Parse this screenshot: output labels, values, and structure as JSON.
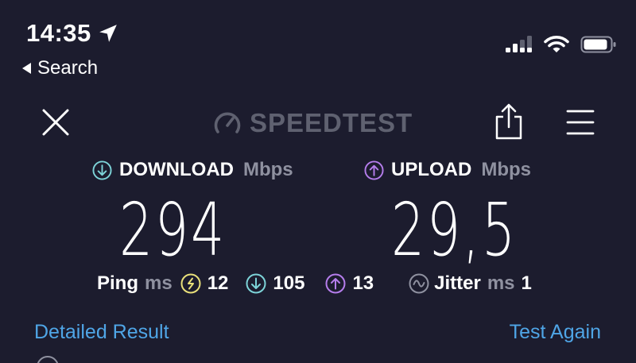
{
  "status_bar": {
    "time": "14:35",
    "back_label": "Search",
    "icons": [
      "location-arrow-icon",
      "cellular-signal-icon",
      "wifi-icon",
      "battery-icon"
    ]
  },
  "header": {
    "brand": "SPEEDTEST",
    "icons": [
      "close-icon",
      "speedometer-logo-icon",
      "share-icon",
      "menu-icon"
    ]
  },
  "download": {
    "label": "DOWNLOAD",
    "unit": "Mbps",
    "value": "294",
    "color": "#7dd3d8"
  },
  "upload": {
    "label": "UPLOAD",
    "unit": "Mbps",
    "value": "29,5",
    "color": "#b57dec"
  },
  "ping": {
    "label": "Ping",
    "unit": "ms",
    "idle": "12",
    "idle_color": "#e9e07a",
    "download": "105",
    "upload": "13"
  },
  "jitter": {
    "label": "Jitter",
    "unit": "ms",
    "value": "1"
  },
  "actions": {
    "detailed_result": "Detailed Result",
    "test_again": "Test Again",
    "link_color": "#4fa5e6"
  }
}
